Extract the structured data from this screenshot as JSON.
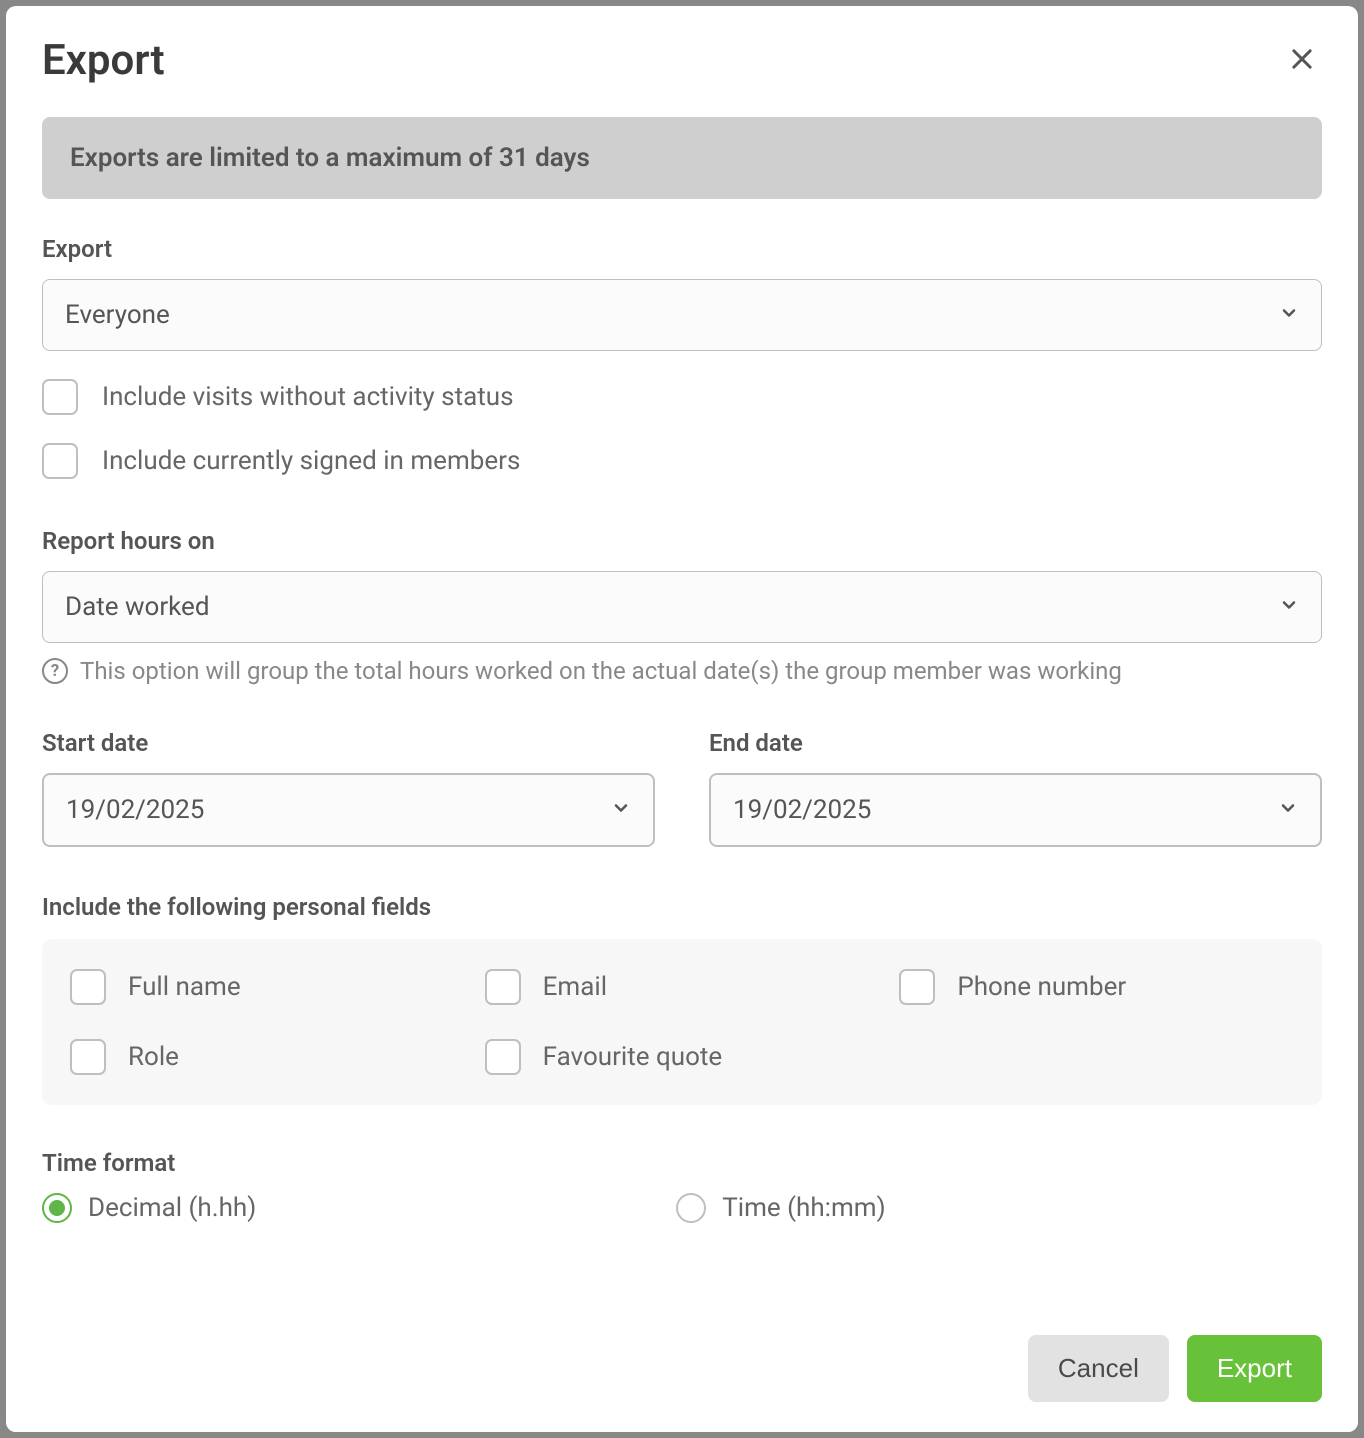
{
  "modal": {
    "title": "Export",
    "banner": "Exports are limited to a maximum of 31 days",
    "exportLabel": "Export",
    "exportSelectValue": "Everyone",
    "checkbox_no_activity": "Include visits without activity status",
    "checkbox_signed_in": "Include currently signed in members",
    "reportHoursLabel": "Report hours on",
    "reportHoursValue": "Date worked",
    "reportHoursHelper": "This option will group the total hours worked on the actual date(s) the group member was working",
    "startDateLabel": "Start date",
    "startDateValue": "19/02/2025",
    "endDateLabel": "End date",
    "endDateValue": "19/02/2025",
    "personalFieldsLabel": "Include the following personal fields",
    "personalFields": {
      "fullName": "Full name",
      "email": "Email",
      "phone": "Phone number",
      "role": "Role",
      "favQuote": "Favourite quote"
    },
    "timeFormatLabel": "Time format",
    "timeFormatDecimal": "Decimal (h.hh)",
    "timeFormatTime": "Time (hh:mm)",
    "footer": {
      "cancel": "Cancel",
      "export": "Export"
    }
  }
}
